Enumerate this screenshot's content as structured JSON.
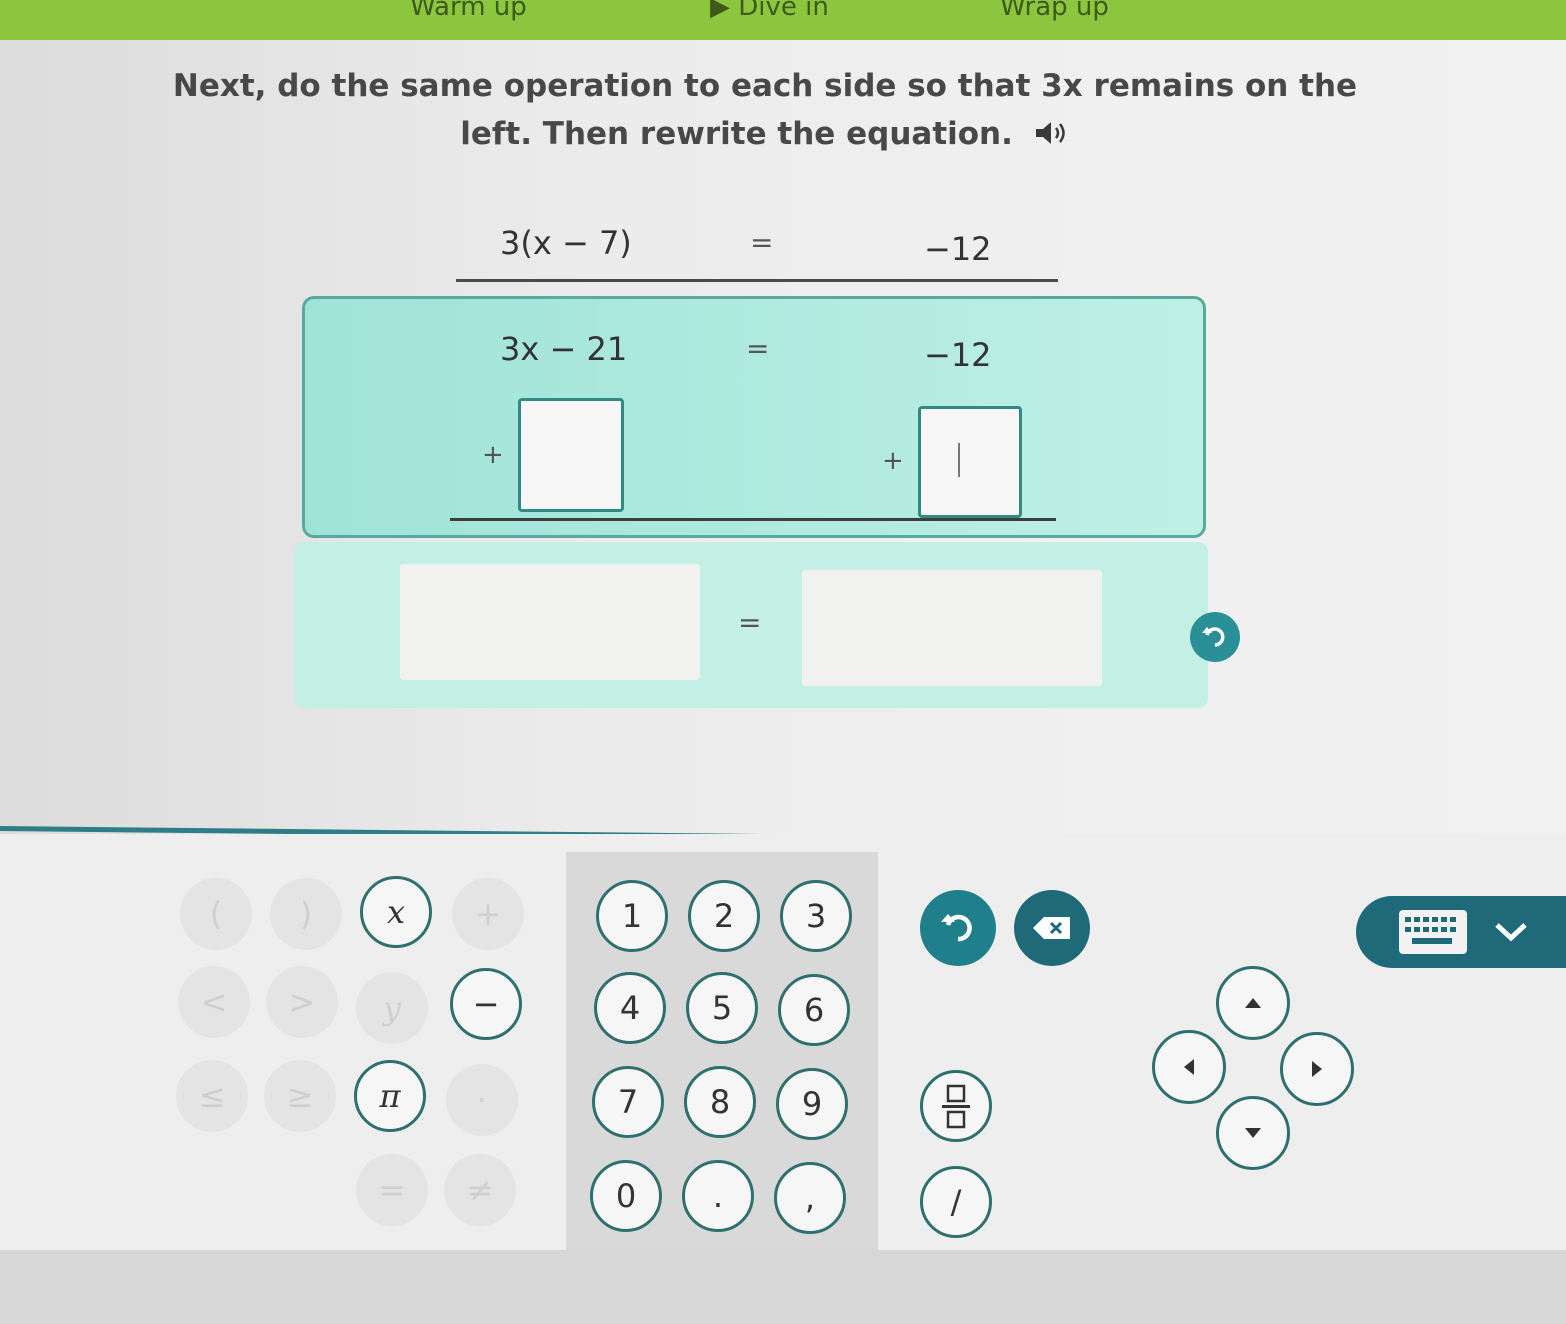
{
  "progress": {
    "steps": [
      "Warm up",
      "Dive in",
      "Wrap up"
    ]
  },
  "instruction": {
    "text": "Next, do the same operation to each side so that 3x remains on the left. Then rewrite the equation."
  },
  "equation_row1": {
    "left": "3(x − 7)",
    "equals": "=",
    "right": "−12"
  },
  "step_box": {
    "left": "3x − 21",
    "equals": "=",
    "right": "−12",
    "left_op": "+",
    "right_op": "+",
    "left_input_value": "",
    "right_input_value": ""
  },
  "answer_row": {
    "left_value": "",
    "equals": "=",
    "right_value": ""
  },
  "keypad": {
    "symbol_keys": [
      "(",
      ")",
      "x",
      "+",
      "<",
      ">",
      "y",
      "−",
      "≤",
      "≥",
      "π",
      "·",
      "=",
      "≠"
    ],
    "number_keys": [
      "1",
      "2",
      "3",
      "4",
      "5",
      "6",
      "7",
      "8",
      "9",
      "0",
      ".",
      ","
    ],
    "fraction_key": "fraction",
    "slash_key": "/"
  },
  "colors": {
    "progress_bar": "#8cc63f",
    "accent_teal": "#1f7f8a",
    "box_fill": "#bff0e6"
  }
}
